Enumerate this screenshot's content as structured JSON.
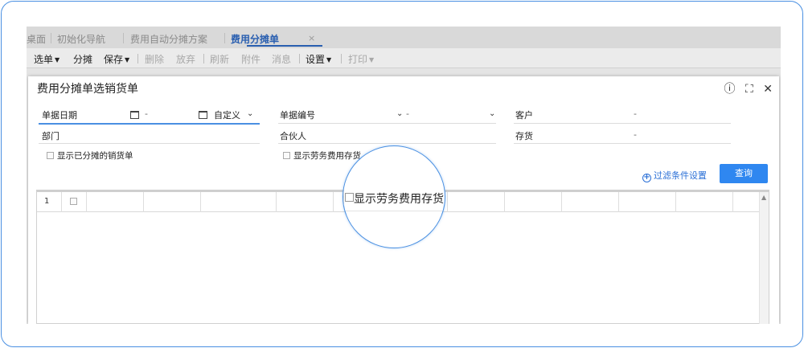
{
  "tabs": [
    {
      "label": "桌面",
      "active": false
    },
    {
      "label": "初始化导航",
      "active": false
    },
    {
      "label": "费用自动分摊方案",
      "active": false
    },
    {
      "label": "费用分摊单",
      "active": true
    }
  ],
  "tab_close_glyph": "×",
  "toolbar": {
    "select": "选单",
    "allocate": "分摊",
    "save": "保存",
    "delete": "删除",
    "discard": "放弃",
    "refresh": "刷新",
    "attachment": "附件",
    "message": "消息",
    "settings": "设置",
    "print": "打印"
  },
  "dialog": {
    "title": "费用分摊单选销货单",
    "icons": {
      "help": "help-icon",
      "maximize": "maximize-icon",
      "close": "close-icon"
    },
    "filters": {
      "doc_date_label": "单据日期",
      "date_dash": "-",
      "date_mode": "自定义",
      "doc_no_label": "单据编号",
      "doc_no_dash": "-",
      "customer_label": "客户",
      "customer_dash": "-",
      "dept_label": "部门",
      "partner_label": "合伙人",
      "inventory_label": "存货",
      "inventory_dash": "-",
      "show_allocated": "显示已分摊的销货单",
      "show_labor": "显示劳务费用存货"
    },
    "filter_settings_link": "过滤条件设置",
    "query_button": "查询"
  },
  "grid": {
    "rows": [
      {
        "num": "1"
      }
    ]
  },
  "magnifier": {
    "text": "显示劳务费用存货"
  },
  "colors": {
    "accent": "#2f87f0",
    "frame_border": "#4a90e2",
    "active_tab": "#2a5fb0"
  }
}
